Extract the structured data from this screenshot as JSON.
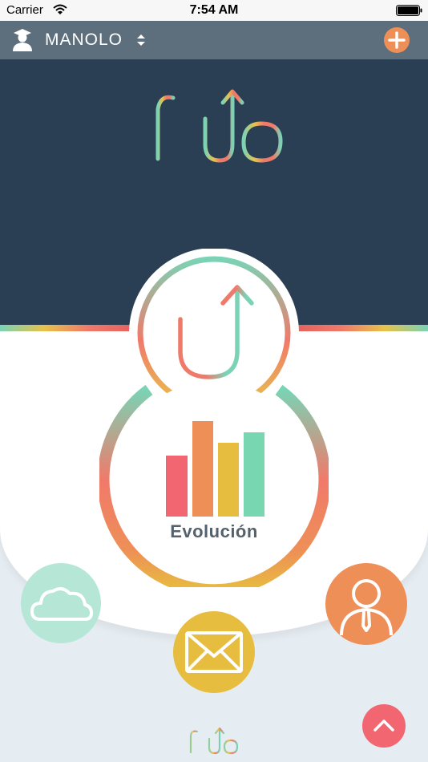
{
  "status_bar": {
    "carrier": "Carrier",
    "time": "7:54 AM"
  },
  "nav": {
    "user_name": "MANOLO"
  },
  "app": {
    "logo_text": "Flup"
  },
  "main_button": {
    "label": "Evolución"
  },
  "colors": {
    "hero_bg": "#2a3f53",
    "nav_bg": "#5d6f7d",
    "mint": "#78d6b1",
    "yellow": "#e7bd3f",
    "orange": "#ee8f57",
    "coral": "#f26671"
  },
  "icons": [
    "wifi-icon",
    "battery-icon",
    "user-avatar-icon",
    "sort-arrows-icon",
    "add-icon",
    "arrow-up-icon",
    "bar-chart-icon",
    "cloud-icon",
    "mail-icon",
    "profile-icon",
    "chevron-up-icon"
  ]
}
